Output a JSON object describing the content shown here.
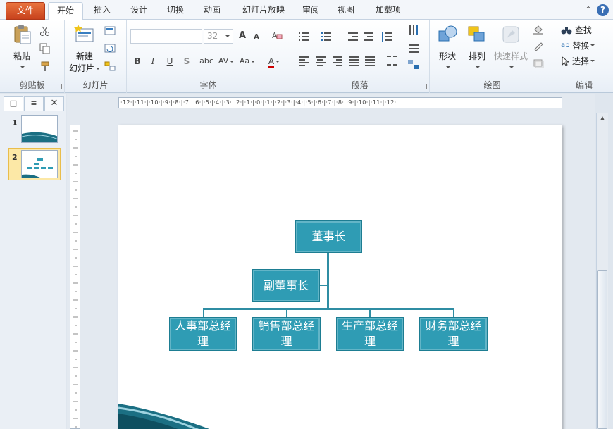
{
  "tabs": {
    "file": "文件",
    "home": "开始",
    "insert": "插入",
    "design": "设计",
    "transitions": "切换",
    "animations": "动画",
    "slideshow": "幻灯片放映",
    "review": "审阅",
    "view": "视图",
    "addins": "加载项"
  },
  "help": "?",
  "collapse": "⌃",
  "ribbon": {
    "clipboard": {
      "label": "剪贴板",
      "paste": "粘贴"
    },
    "slides": {
      "label": "幻灯片",
      "new_slide_line1": "新建",
      "new_slide_line2": "幻灯片"
    },
    "font": {
      "label": "字体",
      "font_name": "",
      "font_size": "32",
      "bold": "B",
      "italic": "I",
      "underline": "U",
      "shadow": "S",
      "strike": "abc",
      "spacing": "AV",
      "case": "Aa",
      "color": "A",
      "grow": "A",
      "shrink": "A"
    },
    "paragraph": {
      "label": "段落"
    },
    "drawing": {
      "label": "绘图",
      "shapes": "形状",
      "arrange": "排列",
      "quick_styles": "快速样式"
    },
    "editing": {
      "label": "编辑",
      "find": "查找",
      "replace": "替换",
      "select": "选择"
    }
  },
  "left_pane": {
    "tab_slides": "□",
    "tab_outline": "≡",
    "close": "✕",
    "slides": [
      {
        "number": "1"
      },
      {
        "number": "2"
      }
    ]
  },
  "ruler_h_text": "·12·|·11·|·10·|·9·|·8·|·7·|·6·|·5·|·4·|·3·|·2·|·1·|·0·|·1·|·2·|·3·|·4·|·5·|·6·|·7·|·8·|·9·|·10·|·11·|·12·",
  "org_chart": {
    "root": "董事长",
    "assistant": "副董事长",
    "children": [
      {
        "line1": "人事部总经",
        "line2": "理"
      },
      {
        "line1": "销售部总经",
        "line2": "理"
      },
      {
        "line1": "生产部总经",
        "line2": "理"
      },
      {
        "line1": "财务部总经",
        "line2": "理"
      }
    ]
  },
  "colors": {
    "accent_box": "#2f9cb4",
    "file_tab": "#d9532c",
    "slide_wave": "#1b6f83"
  }
}
